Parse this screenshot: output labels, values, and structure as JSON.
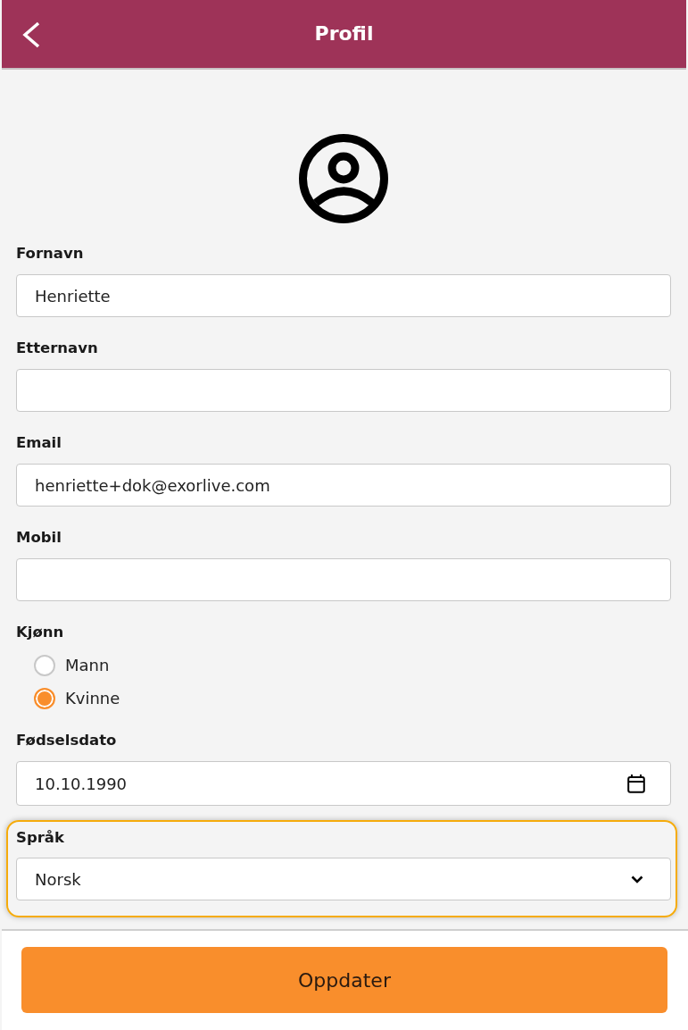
{
  "header": {
    "title": "Profil"
  },
  "form": {
    "fields": [
      {
        "kind": "text",
        "label": "Fornavn",
        "value": "Henriette"
      },
      {
        "kind": "text",
        "label": "Etternavn"
      },
      {
        "kind": "text",
        "label": "Email",
        "value": "henriette+dok@exorlive.com"
      },
      {
        "kind": "text",
        "label": "Mobil"
      },
      {
        "kind": "radio",
        "label": "Kjønn",
        "options": [
          {
            "label": "Mann",
            "selected": false
          },
          {
            "label": "Kvinne",
            "selected": true
          }
        ]
      },
      {
        "kind": "date",
        "label": "Fødselsdato",
        "value": "10.10.1990"
      },
      {
        "kind": "select",
        "label": "Språk",
        "value": "Norsk",
        "highlighted": true
      }
    ]
  },
  "footer": {
    "button": "Oppdater"
  }
}
